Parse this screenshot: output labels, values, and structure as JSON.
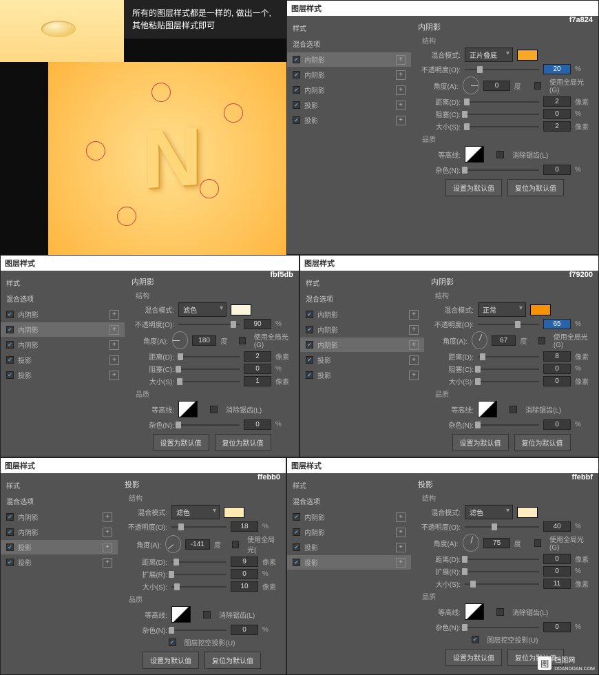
{
  "note_text": "所有的图层样式都是一样的,\n做出一个,其他粘贴图层样式即可",
  "common": {
    "dialog_title": "图层样式",
    "styles_header": "样式",
    "blend_options": "混合选项",
    "structure": "结构",
    "quality": "品质",
    "blend_mode_lbl": "混合模式:",
    "opacity_lbl": "不透明度(O):",
    "angle_lbl": "角度(A):",
    "distance_lbl": "距离(D):",
    "choke_lbl": "阻塞(C):",
    "spread_lbl": "扩展(R):",
    "size_lbl": "大小(S):",
    "contour_lbl": "等高线:",
    "noise_lbl": "杂色(N):",
    "global_light": "使用全局光(G)",
    "anti_alias": "消除锯齿(L)",
    "knockout": "图层挖空投影(U)",
    "make_default": "设置为默认值",
    "reset_default": "复位为默认值",
    "pct": "%",
    "deg": "度",
    "px": "像素"
  },
  "panels": [
    {
      "id": "p1",
      "title": "内阴影",
      "hex": "f7a824",
      "swatch": "#f7a824",
      "blend_mode": "正片叠底",
      "effects": [
        {
          "label": "内阴影",
          "checked": true,
          "sel": true
        },
        {
          "label": "内阴影",
          "checked": true,
          "sel": false
        },
        {
          "label": "内阴影",
          "checked": true,
          "sel": false
        },
        {
          "label": "投影",
          "checked": true,
          "sel": false
        },
        {
          "label": "投影",
          "checked": true,
          "sel": false
        }
      ],
      "rows": [
        {
          "label": "opacity",
          "val": "20",
          "hl": true,
          "unit": "%",
          "thumb": 20
        },
        {
          "type": "angle",
          "val": "0",
          "global": false
        },
        {
          "label": "distance",
          "val": "2",
          "unit": "px",
          "thumb": 3
        },
        {
          "label": "choke",
          "val": "0",
          "unit": "%",
          "thumb": 0
        },
        {
          "label": "size",
          "val": "2",
          "unit": "px",
          "thumb": 3
        }
      ],
      "noise": "0",
      "knockout": false
    },
    {
      "id": "p2",
      "title": "内阴影",
      "hex": "fbf5db",
      "swatch": "#fbf5db",
      "blend_mode": "滤色",
      "effects": [
        {
          "label": "内阴影",
          "checked": true,
          "sel": false
        },
        {
          "label": "内阴影",
          "checked": true,
          "sel": true
        },
        {
          "label": "内阴影",
          "checked": true,
          "sel": false
        },
        {
          "label": "投影",
          "checked": true,
          "sel": false
        },
        {
          "label": "投影",
          "checked": true,
          "sel": false
        }
      ],
      "rows": [
        {
          "label": "opacity",
          "val": "90",
          "unit": "%",
          "thumb": 90
        },
        {
          "type": "angle",
          "val": "180",
          "global": false
        },
        {
          "label": "distance",
          "val": "2",
          "unit": "px",
          "thumb": 3
        },
        {
          "label": "choke",
          "val": "0",
          "unit": "%",
          "thumb": 0
        },
        {
          "label": "size",
          "val": "1",
          "unit": "px",
          "thumb": 2
        }
      ],
      "noise": "0",
      "knockout": false
    },
    {
      "id": "p3",
      "title": "内阴影",
      "hex": "f79200",
      "swatch": "#f79200",
      "blend_mode": "正常",
      "effects": [
        {
          "label": "内阴影",
          "checked": true,
          "sel": false
        },
        {
          "label": "内阴影",
          "checked": true,
          "sel": false
        },
        {
          "label": "内阴影",
          "checked": true,
          "sel": true
        },
        {
          "label": "投影",
          "checked": true,
          "sel": false
        },
        {
          "label": "投影",
          "checked": true,
          "sel": false
        }
      ],
      "rows": [
        {
          "label": "opacity",
          "val": "65",
          "hl": true,
          "unit": "%",
          "thumb": 65
        },
        {
          "type": "angle",
          "val": "67",
          "global": false
        },
        {
          "label": "distance",
          "val": "8",
          "unit": "px",
          "thumb": 8
        },
        {
          "label": "choke",
          "val": "0",
          "unit": "%",
          "thumb": 0
        },
        {
          "label": "size",
          "val": "0",
          "unit": "px",
          "thumb": 0
        }
      ],
      "noise": "0",
      "knockout": false
    },
    {
      "id": "p4",
      "title": "投影",
      "hex": "ffebb0",
      "swatch": "#ffebb0",
      "blend_mode": "滤色",
      "effects": [
        {
          "label": "内阴影",
          "checked": true,
          "sel": false
        },
        {
          "label": "内阴影",
          "checked": true,
          "sel": false
        },
        {
          "label": "投影",
          "checked": true,
          "sel": true
        },
        {
          "label": "投影",
          "checked": true,
          "sel": false
        }
      ],
      "rows": [
        {
          "label": "opacity",
          "val": "18",
          "unit": "%",
          "thumb": 18
        },
        {
          "type": "angle",
          "val": "-141",
          "global": false,
          "globalTrunc": "使用全局光("
        },
        {
          "label": "distance",
          "val": "9",
          "unit": "px",
          "thumb": 9
        },
        {
          "label": "spread",
          "val": "0",
          "unit": "%",
          "thumb": 0
        },
        {
          "label": "size",
          "val": "10",
          "unit": "px",
          "thumb": 10
        }
      ],
      "noise": "0",
      "knockout": true
    },
    {
      "id": "p5",
      "title": "投影",
      "hex": "ffebbf",
      "swatch": "#ffebbf",
      "blend_mode": "滤色",
      "effects": [
        {
          "label": "内阴影",
          "checked": true,
          "sel": false
        },
        {
          "label": "内阴影",
          "checked": true,
          "sel": false
        },
        {
          "label": "投影",
          "checked": true,
          "sel": false
        },
        {
          "label": "投影",
          "checked": true,
          "sel": true
        }
      ],
      "rows": [
        {
          "label": "opacity",
          "val": "40",
          "unit": "%",
          "thumb": 40
        },
        {
          "type": "angle",
          "val": "75",
          "global": false
        },
        {
          "label": "distance",
          "val": "0",
          "unit": "px",
          "thumb": 0
        },
        {
          "label": "spread",
          "val": "0",
          "unit": "%",
          "thumb": 0
        },
        {
          "label": "size",
          "val": "11",
          "unit": "px",
          "thumb": 11
        }
      ],
      "noise": "0",
      "knockout": true
    }
  ],
  "watermark": {
    "brand": "铛图网",
    "url": "DOANDOAN.COM"
  }
}
